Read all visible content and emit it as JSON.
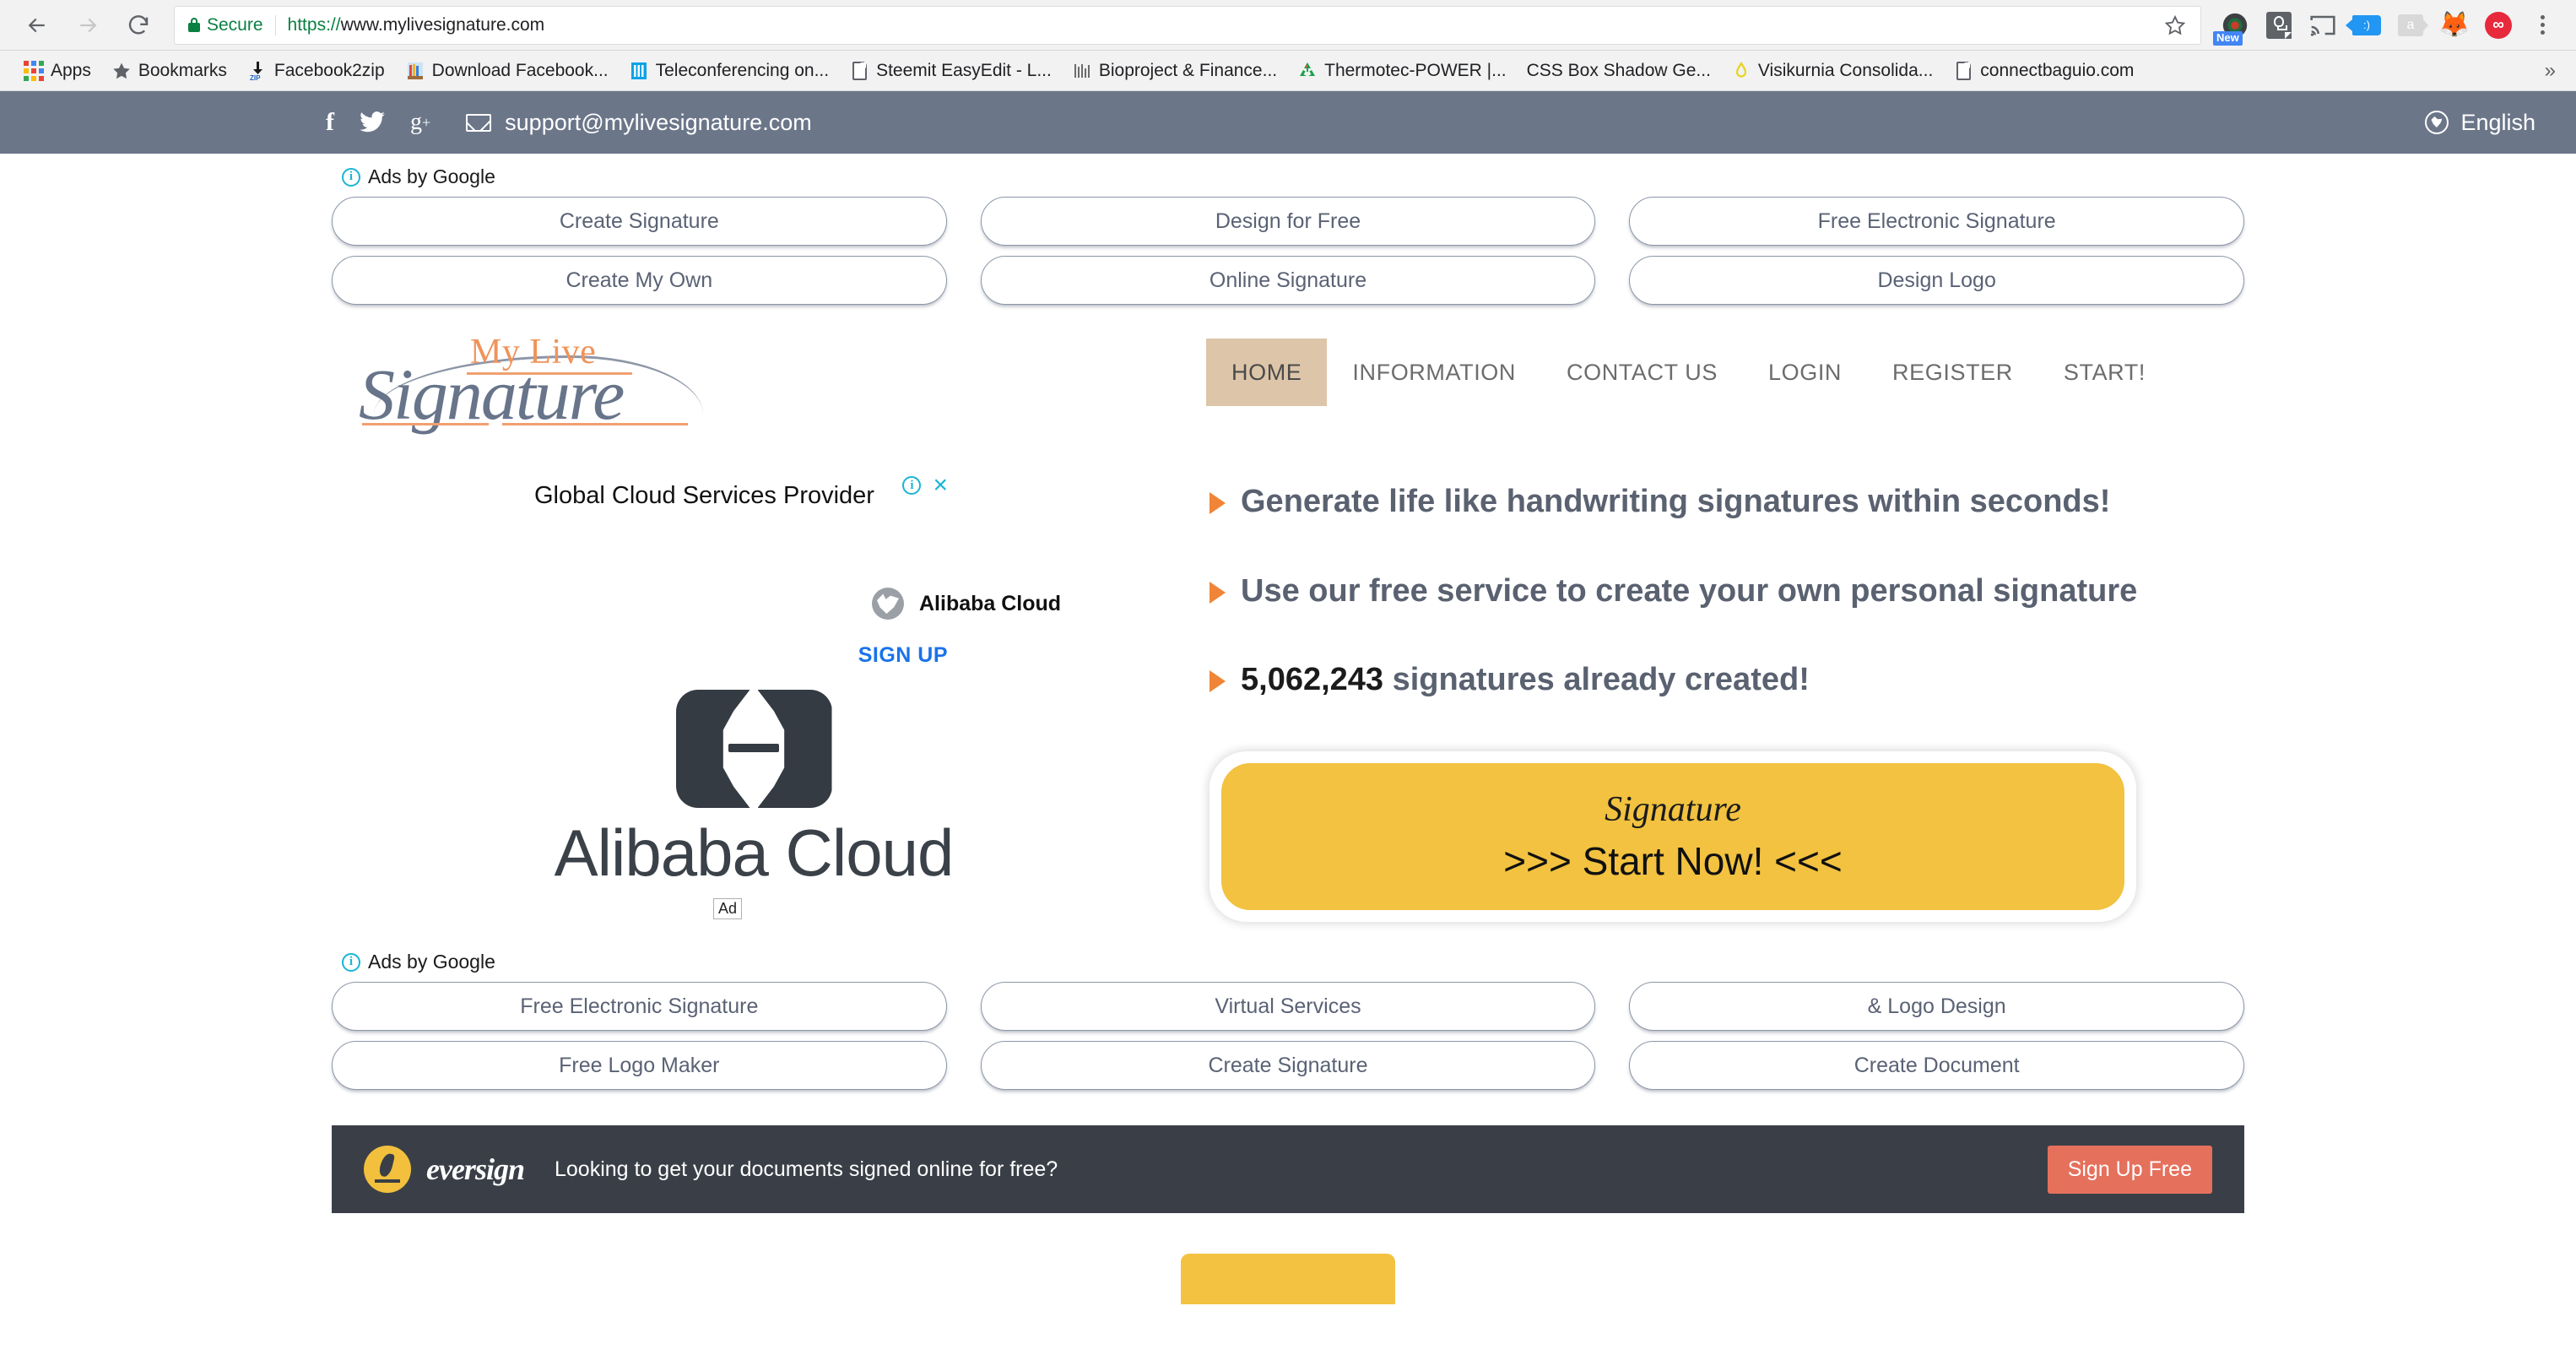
{
  "browser": {
    "back_label": "Back",
    "forward_label": "Forward",
    "reload_label": "Reload",
    "security_label": "Secure",
    "url_scheme": "https://",
    "url_host": "www.mylivesignature.com",
    "star_label": "Bookmark this page",
    "extension_new_badge": "New",
    "menu_label": "Customize and control Google Chrome",
    "bookmarks": [
      {
        "label": "Apps",
        "icon": "apps-grid-icon"
      },
      {
        "label": "Bookmarks",
        "icon": "star-icon"
      },
      {
        "label": "Facebook2zip",
        "icon": "zip-download-icon"
      },
      {
        "label": "Download Facebook...",
        "icon": "colorful-folder-icon"
      },
      {
        "label": "Teleconferencing on...",
        "icon": "blue-bars-icon"
      },
      {
        "label": "Steemit EasyEdit - L...",
        "icon": "document-icon"
      },
      {
        "label": "Bioproject & Finance...",
        "icon": "gray-glyph-icon"
      },
      {
        "label": "Thermotec-POWER |...",
        "icon": "recycle-icon"
      },
      {
        "label": "CSS Box Shadow Ge...",
        "icon": "none"
      },
      {
        "label": "Visikurnia Consolida...",
        "icon": "yellow-drop-icon"
      },
      {
        "label": "connectbaguio.com",
        "icon": "document-icon"
      }
    ],
    "overflow_label": "»"
  },
  "site_header": {
    "social": [
      {
        "name": "facebook-icon",
        "glyph": "f"
      },
      {
        "name": "twitter-icon",
        "glyph": "🐦"
      },
      {
        "name": "google-plus-icon",
        "glyph": "g+"
      }
    ],
    "email": "support@mylivesignature.com",
    "language": "English",
    "background_color": "#6b7689"
  },
  "top_ads": {
    "label": "Ads by Google",
    "buttons": [
      "Create Signature",
      "Design for Free",
      "Free Electronic Signature",
      "Create My Own",
      "Online Signature",
      "Design Logo"
    ]
  },
  "brand": {
    "logo_top": "My Live",
    "logo_bottom": "Signature",
    "accent_color": "#f0935a",
    "script_color": "#67748a"
  },
  "nav": {
    "items": [
      {
        "label": "HOME",
        "active": true
      },
      {
        "label": "INFORMATION",
        "active": false
      },
      {
        "label": "CONTACT US",
        "active": false
      },
      {
        "label": "LOGIN",
        "active": false
      },
      {
        "label": "REGISTER",
        "active": false
      },
      {
        "label": "START!",
        "active": false
      }
    ],
    "active_background": "#ddc5a9"
  },
  "ad_card": {
    "headline": "Global Cloud Services Provider",
    "advertiser": "Alibaba Cloud",
    "cta": "SIGN UP",
    "brand_text": "Alibaba Cloud",
    "ad_badge": "Ad",
    "info_label": "Why this ad?",
    "close_label": "Close ad"
  },
  "features": {
    "bullets": [
      {
        "text": "Generate life like handwriting signatures within seconds!",
        "count": ""
      },
      {
        "text": "Use our free service to create your own personal signature",
        "count": ""
      },
      {
        "text": " signatures already created!",
        "count": "5,062,243"
      }
    ],
    "bullet_color": "#f08437"
  },
  "cta": {
    "script_label": "Signature",
    "main_label": ">>> Start Now! <<<",
    "background_color": "#f2c240"
  },
  "bottom_ads": {
    "label": "Ads by Google",
    "buttons": [
      "Free Electronic Signature",
      "Virtual Services",
      "& Logo Design",
      "Free Logo Maker",
      "Create Signature",
      "Create Document"
    ]
  },
  "eversign": {
    "brand": "eversign",
    "message": "Looking to get your documents signed online for free?",
    "cta": "Sign Up Free",
    "background_color": "#3a3f47",
    "cta_color": "#e5705c"
  }
}
